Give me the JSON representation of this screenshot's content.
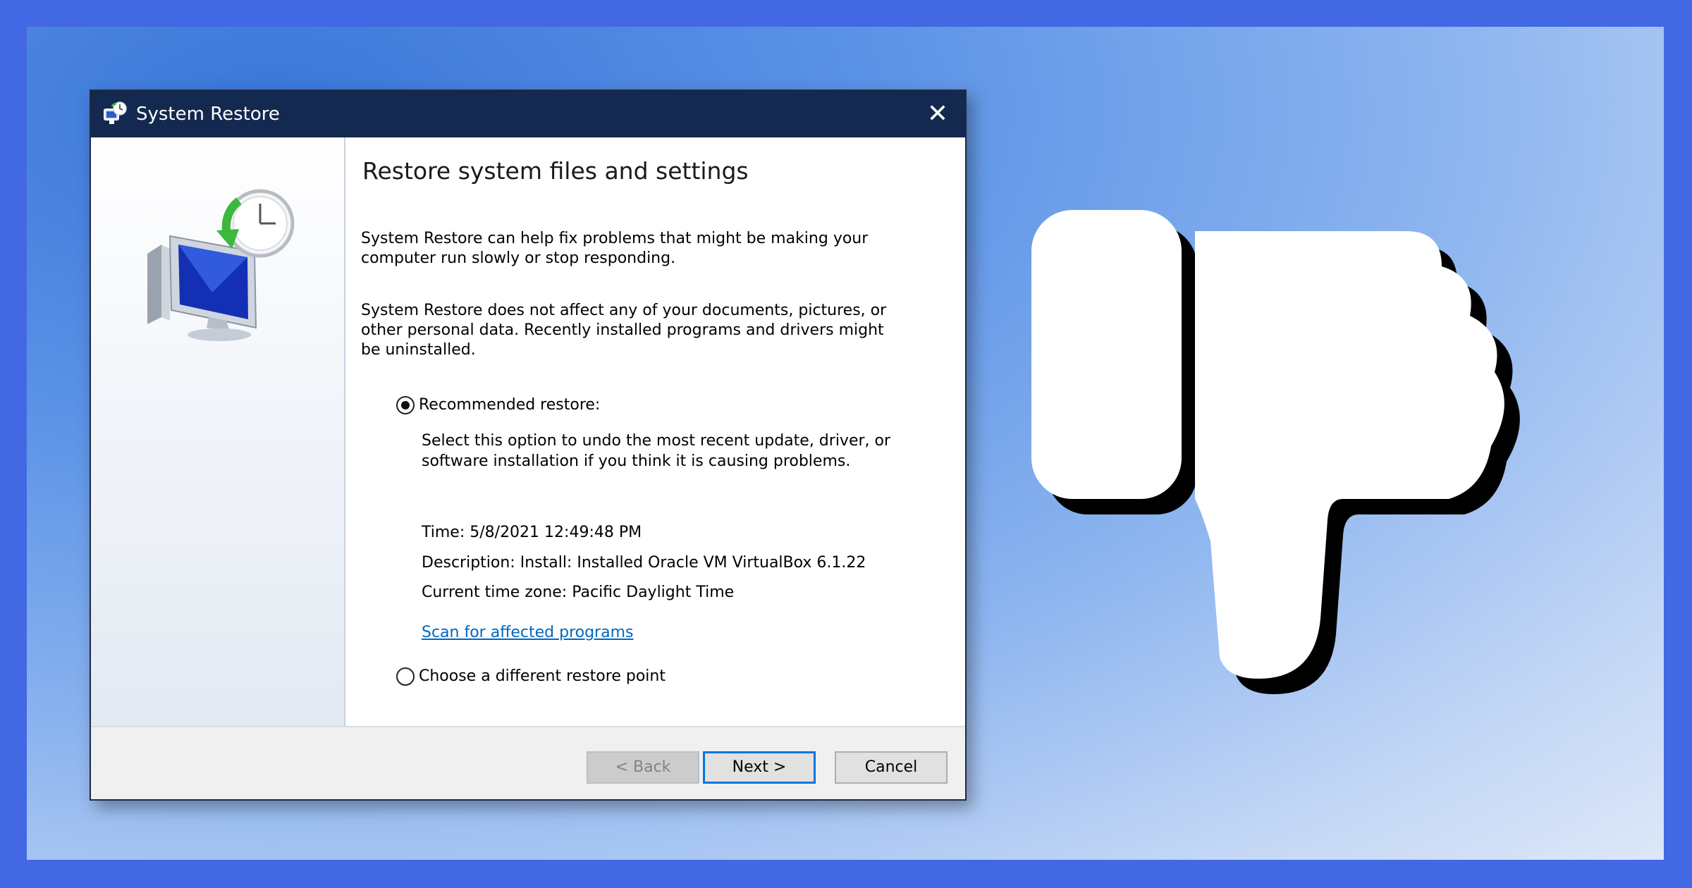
{
  "window": {
    "title": "System Restore",
    "close_glyph": "✕"
  },
  "content": {
    "heading": "Restore system files and settings",
    "paragraph1": "System Restore can help fix problems that might be making your computer run slowly or stop responding.",
    "paragraph2": "System Restore does not affect any of your documents, pictures, or other personal data. Recently installed programs and drivers might be uninstalled.",
    "recommended": {
      "label": "Recommended restore:",
      "selected": true,
      "description": "Select this option to undo the most recent update, driver, or software installation if you think it is causing problems.",
      "time": "Time: 5/8/2021 12:49:48 PM",
      "desc_line": "Description: Install: Installed Oracle VM VirtualBox 6.1.22",
      "timezone": "Current time zone: Pacific Daylight Time",
      "scan_link": "Scan for affected programs"
    },
    "different": {
      "label": "Choose a different restore point",
      "selected": false
    }
  },
  "footer": {
    "back_label": "< Back",
    "next_label": "Next >",
    "cancel_label": "Cancel"
  },
  "icons": {
    "app": "system-restore-icon",
    "hero": "monitor-clock-restore-icon",
    "thumb": "thumbs-down-icon"
  },
  "colors": {
    "outer_border": "#4268e3",
    "titlebar": "#14294f",
    "link": "#0067c0",
    "focus_button_border": "#0078d7"
  }
}
